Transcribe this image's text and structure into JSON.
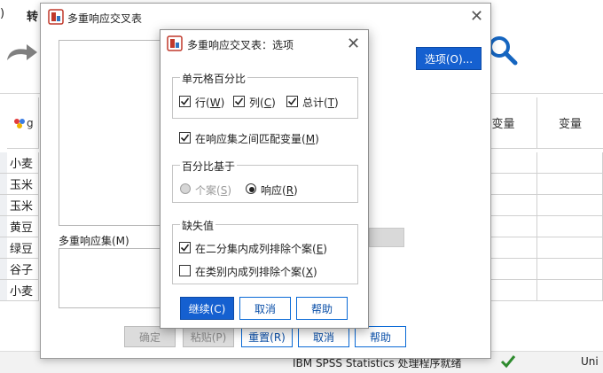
{
  "bg": {
    "menu_left": ")",
    "menu_convert": "转",
    "col_header_a": "变量",
    "col_header_b": "变量",
    "var_icon_label": "g",
    "rows": [
      "小麦",
      "玉米",
      "玉米",
      "黄豆",
      "绿豆",
      "谷子",
      "小麦"
    ],
    "status_text": "IBM SPSS Statistics 处理程序就绪",
    "status_right": "Uni"
  },
  "main_dialog": {
    "title": "多重响应交叉表",
    "options_button": "选项(O)...",
    "multi_set_label": "多重响应集(M)",
    "buttons": {
      "ok": "确定",
      "paste": "粘贴(P)",
      "reset": "重置(R)",
      "cancel": "取消",
      "help": "帮助"
    }
  },
  "options_dialog": {
    "title": "多重响应交叉表：选项",
    "cell_percent": {
      "title": "单元格百分比",
      "row": {
        "label": "行",
        "key": "W",
        "checked": true
      },
      "col": {
        "label": "列",
        "key": "C",
        "checked": true
      },
      "total": {
        "label": "总计",
        "key": "T",
        "checked": true
      }
    },
    "match_vars": {
      "label": "在响应集之间匹配变量",
      "key": "M",
      "checked": true
    },
    "percent_base": {
      "title": "百分比基于",
      "cases": {
        "label": "个案",
        "key": "S",
        "disabled": true,
        "checked": false
      },
      "responses": {
        "label": "响应",
        "key": "R",
        "checked": true
      }
    },
    "missing": {
      "title": "缺失值",
      "dichotomy": {
        "label": "在二分集内成列排除个案",
        "key": "E",
        "checked": true
      },
      "category": {
        "label": "在类别内成列排除个案",
        "key": "X",
        "checked": false
      }
    },
    "buttons": {
      "continue": "继续(C)",
      "cancel": "取消",
      "help": "帮助"
    }
  },
  "colors": {
    "accent": "#1560d0",
    "link_text": "#0a4fa8",
    "disabled_bg": "#dcdcdc"
  }
}
